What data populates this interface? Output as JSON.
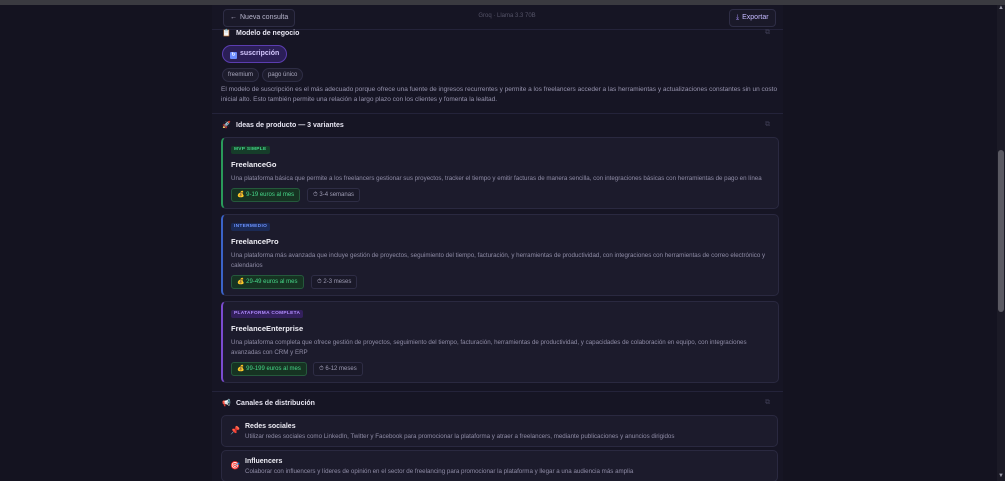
{
  "header": {
    "back_icon": "arrow-left-icon",
    "new_query": "Nueva consulta",
    "model_label": "Groq · Llama 3.3 70B",
    "export_icon": "download-icon",
    "export": "Exportar"
  },
  "business_model": {
    "icon": "clipboard-icon",
    "title": "Modelo de negocio",
    "selected": "suscripción",
    "selected_icon": "repeat-box-icon",
    "alternatives": [
      "freemium",
      "pago único"
    ],
    "description": "El modelo de suscripción es el más adecuado porque ofrece una fuente de ingresos recurrentes y permite a los freelancers acceder a las herramientas y actualizaciones constantes sin un costo inicial alto. Esto también permite una relación a largo plazo con los clientes y fomenta la lealtad."
  },
  "product_ideas": {
    "icon": "rocket-icon",
    "title": "Ideas de producto — 3 variantes",
    "variants": [
      {
        "badge": "MVP SIMPLE",
        "name": "FreelanceGo",
        "description": "Una plataforma básica que permite a los freelancers gestionar sus proyectos, tracker el tiempo y emitir facturas de manera sencilla, con integraciones básicas con herramientas de pago en línea",
        "price": "9-19 euros al mes",
        "time": "3-4 semanas"
      },
      {
        "badge": "INTERMEDIO",
        "name": "FreelancePro",
        "description": "Una plataforma más avanzada que incluye gestión de proyectos, seguimiento del tiempo, facturación, y herramientas de productividad, con integraciones con herramientas de correo electrónico y calendarios",
        "price": "29-49 euros al mes",
        "time": "2-3 meses"
      },
      {
        "badge": "PLATAFORMA COMPLETA",
        "name": "FreelanceEnterprise",
        "description": "Una plataforma completa que ofrece gestión de proyectos, seguimiento del tiempo, facturación, herramientas de productividad, y capacidades de colaboración en equipo, con integraciones avanzadas con CRM y ERP",
        "price": "99-199 euros al mes",
        "time": "6-12 meses"
      }
    ]
  },
  "distribution": {
    "icon": "megaphone-icon",
    "title": "Canales de distribución",
    "channels": [
      {
        "icon": "pushpin-icon",
        "name": "Redes sociales",
        "description": "Utilizar redes sociales como LinkedIn, Twitter y Facebook para promocionar la plataforma y atraer a freelancers, mediante publicaciones y anuncios dirigidos"
      },
      {
        "icon": "target-icon",
        "name": "Influencers",
        "description": "Colaborar con influencers y líderes de opinión en el sector de freelancing para promocionar la plataforma y llegar a una audiencia más amplia"
      }
    ]
  },
  "colors": {
    "background": "#141320",
    "panel": "#1c1b2c",
    "accent": "#8b6cff",
    "green": "#43d787",
    "blue": "#6c93ff",
    "purple": "#b18cff"
  }
}
